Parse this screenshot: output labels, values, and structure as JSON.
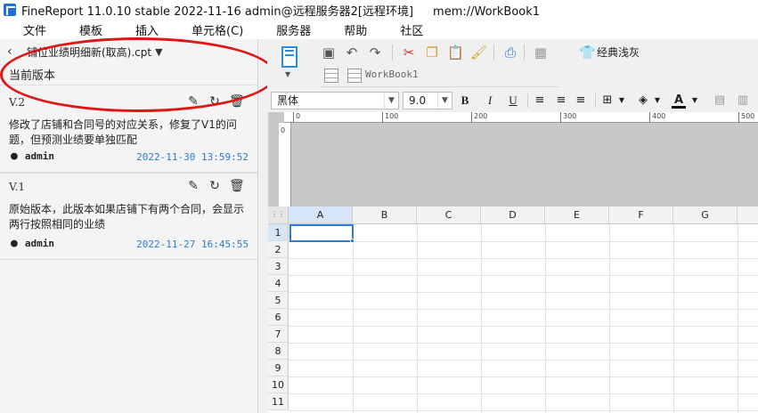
{
  "window": {
    "title": "FineReport 11.0.10 stable 2022-11-16 admin@远程服务器2[远程环境]",
    "path": "mem://WorkBook1"
  },
  "menu": [
    "文件",
    "模板",
    "插入",
    "单元格(C)",
    "服务器",
    "帮助",
    "社区"
  ],
  "panel": {
    "file_name": "铺位业绩明细新(取高).cpt",
    "current_version_label": "当前版本",
    "versions": [
      {
        "label": "V.2",
        "description": "修改了店铺和合同号的对应关系，修复了V1的问题，但预测业绩要单独匹配",
        "author": "admin",
        "time": "2022-11-30 13:59:52"
      },
      {
        "label": "V.1",
        "description": "原始版本，此版本如果店铺下有两个合同，会显示两行按照相同的业绩",
        "author": "admin",
        "time": "2022-11-27 16:45:55"
      }
    ]
  },
  "toolbar": {
    "theme_label": "经典浅灰",
    "workbook_tab": "WorkBook1"
  },
  "format": {
    "font": "黑体",
    "size": "9.0",
    "bold": "B",
    "italic": "I",
    "underline": "U",
    "font_color": "A"
  },
  "ruler": {
    "ticks": [
      "0",
      "100",
      "200",
      "300",
      "400",
      "500"
    ]
  },
  "sheet": {
    "columns": [
      "A",
      "B",
      "C",
      "D",
      "E",
      "F",
      "G"
    ],
    "rows": [
      "1",
      "2",
      "3",
      "4",
      "5",
      "6",
      "7",
      "8",
      "9",
      "10",
      "11"
    ],
    "selected_cell": "A1"
  },
  "colors": {
    "accent": "#2f7cd6",
    "annotation": "#e01616",
    "time": "#2a7bd4"
  }
}
